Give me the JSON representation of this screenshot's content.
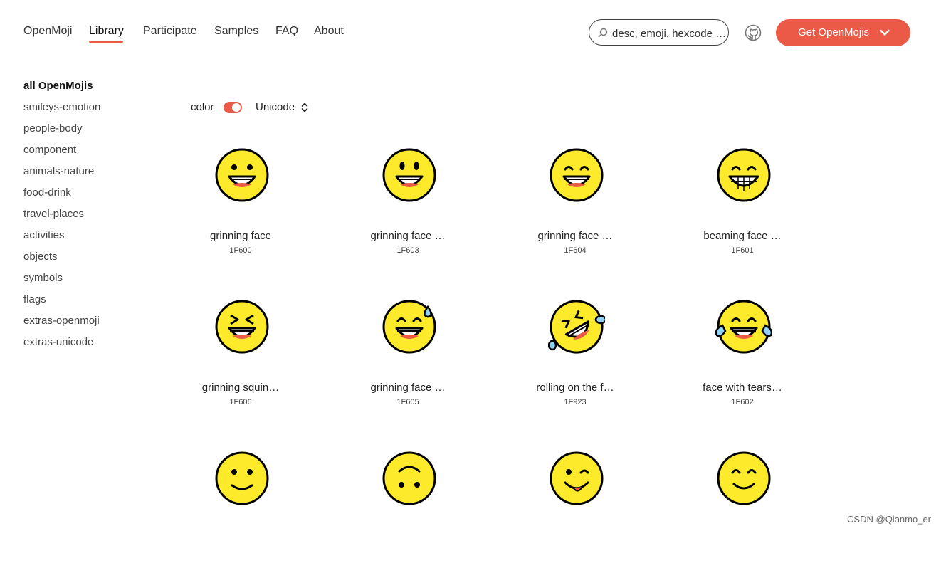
{
  "nav": {
    "items": [
      "OpenMoji",
      "Library",
      "Participate",
      "Samples",
      "FAQ",
      "About"
    ],
    "active_index": 1,
    "search_placeholder": "desc, emoji, hexcode …",
    "cta_label": "Get OpenMojis"
  },
  "sidebar": {
    "items": [
      "all OpenMojis",
      "smileys-emotion",
      "people-body",
      "component",
      "animals-nature",
      "food-drink",
      "travel-places",
      "activities",
      "objects",
      "symbols",
      "flags",
      "extras-openmoji",
      "extras-unicode"
    ],
    "active_index": 0
  },
  "filters": {
    "color_label": "color",
    "color_enabled": true,
    "sort_label": "Unicode"
  },
  "colors": {
    "accent": "#ea5a47",
    "face_fill": "#fcea2b",
    "tear_blue": "#92d3f5",
    "stroke": "#000000"
  },
  "emojis": [
    {
      "name": "grinning face",
      "code": "1F600",
      "variant": "grinning"
    },
    {
      "name": "grinning face …",
      "code": "1F603",
      "variant": "big-eyes"
    },
    {
      "name": "grinning face …",
      "code": "1F604",
      "variant": "smiling-eyes"
    },
    {
      "name": "beaming face …",
      "code": "1F601",
      "variant": "beaming"
    },
    {
      "name": "grinning squin…",
      "code": "1F606",
      "variant": "squinting"
    },
    {
      "name": "grinning face …",
      "code": "1F605",
      "variant": "sweat"
    },
    {
      "name": "rolling on the f…",
      "code": "1F923",
      "variant": "rofl"
    },
    {
      "name": "face with tears…",
      "code": "1F602",
      "variant": "tears-of-joy"
    },
    {
      "name": "",
      "code": "",
      "variant": "slight-smile"
    },
    {
      "name": "",
      "code": "",
      "variant": "upside-down"
    },
    {
      "name": "",
      "code": "",
      "variant": "winking"
    },
    {
      "name": "",
      "code": "",
      "variant": "smiling-eyes-calm"
    }
  ],
  "watermark": "CSDN @Qianmo_er"
}
